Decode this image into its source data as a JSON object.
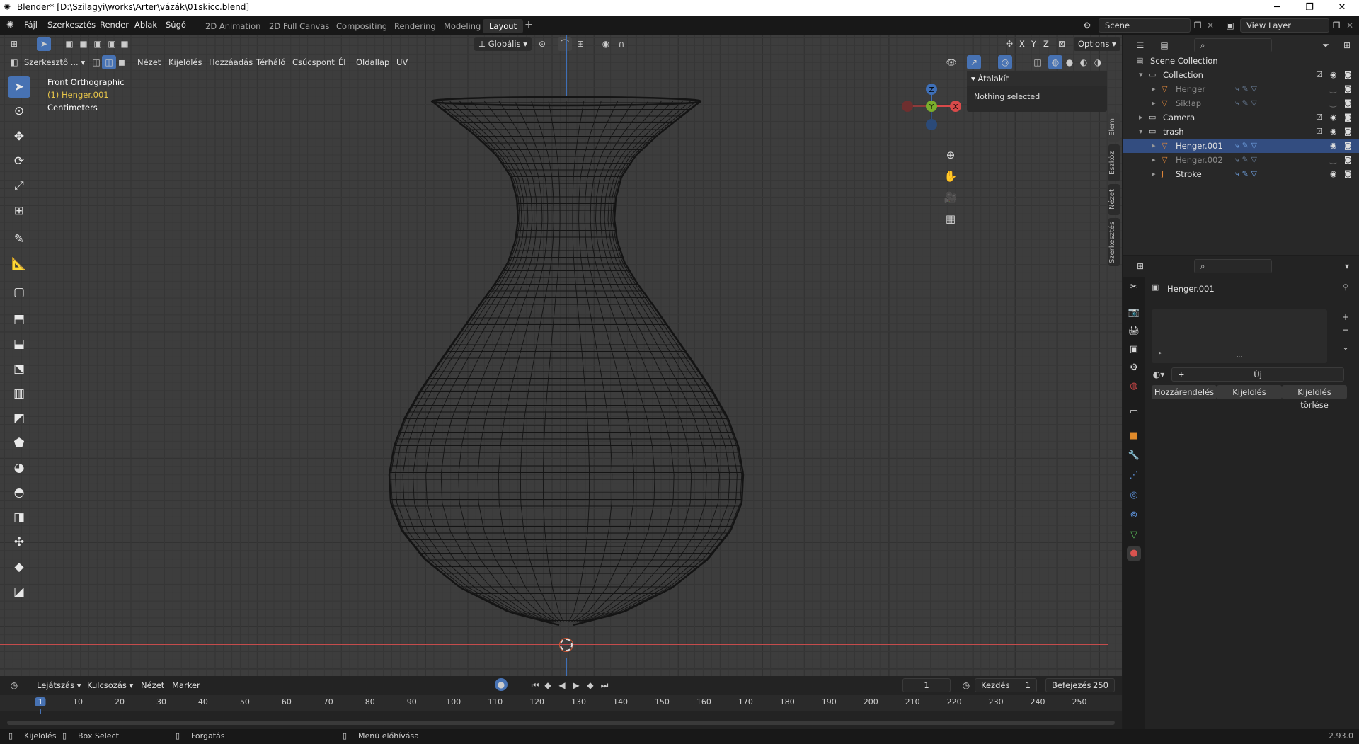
{
  "window": {
    "title": "Blender* [D:\\Szilagyi\\works\\Arter\\vázák\\01skicc.blend]"
  },
  "menu": {
    "items": [
      "Fájl",
      "Szerkesztés",
      "Render",
      "Ablak",
      "Súgó"
    ]
  },
  "workspaces": [
    "2D Animation",
    "2D Full Canvas",
    "Compositing",
    "Rendering",
    "Modeling",
    "Layout"
  ],
  "workspace_active": "Layout",
  "scene": {
    "label": "Scene",
    "view_layer": "View Layer"
  },
  "viewport": {
    "mode": "Szerkesztő ...",
    "menus": [
      "Nézet",
      "Kijelölés",
      "Hozzáadás",
      "Térháló",
      "Csúcspont",
      "Él",
      "Oldallap",
      "UV"
    ],
    "orientation": "Globális",
    "options": "Options",
    "axes": [
      "X",
      "Y",
      "Z"
    ],
    "overlay_view": "Front Orthographic",
    "overlay_object": "(1) Henger.001",
    "overlay_units": "Centimeters",
    "npanel_header": "Átalakít",
    "npanel_text": "Nothing selected",
    "side_tabs": [
      "Elem",
      "Eszköz",
      "Nézet",
      "Szerkesztés"
    ],
    "gizmo": {
      "x": "X",
      "y": "Y",
      "z": "Z"
    }
  },
  "timeline": {
    "menus": [
      "Lejátszás",
      "Kulcsozás",
      "Nézet",
      "Marker"
    ],
    "current_frame": "1",
    "start_label": "Kezdés",
    "start": "1",
    "end_label": "Befejezés",
    "end": "250",
    "ticks": [
      "1",
      "10",
      "20",
      "30",
      "40",
      "50",
      "60",
      "70",
      "80",
      "90",
      "100",
      "110",
      "120",
      "130",
      "140",
      "150",
      "160",
      "170",
      "180",
      "190",
      "200",
      "210",
      "220",
      "230",
      "240",
      "250"
    ]
  },
  "status": {
    "items": [
      "Kijelölés",
      "Box Select",
      "Forgatás",
      "Menü előhívása"
    ],
    "version": "2.93.0"
  },
  "outliner": {
    "rows": [
      {
        "name": "Scene Collection",
        "indent": 0,
        "kind": "scene"
      },
      {
        "name": "Collection",
        "indent": 1,
        "kind": "collection"
      },
      {
        "name": "Henger",
        "indent": 2,
        "kind": "mesh",
        "dim": true
      },
      {
        "name": "Sik!ap",
        "indent": 2,
        "kind": "mesh",
        "dim": true
      },
      {
        "name": "Camera",
        "indent": 1,
        "kind": "collection"
      },
      {
        "name": "trash",
        "indent": 1,
        "kind": "collection"
      },
      {
        "name": "Henger.001",
        "indent": 2,
        "kind": "mesh",
        "selected": true
      },
      {
        "name": "Henger.002",
        "indent": 2,
        "kind": "mesh",
        "dim": true
      },
      {
        "name": "Stroke",
        "indent": 2,
        "kind": "gpencil"
      }
    ]
  },
  "properties": {
    "object_name": "Henger.001",
    "new_button": "Új",
    "buttons": [
      "Hozzárendelés",
      "Kijelölés",
      "Kijelölés törlése"
    ]
  },
  "colors": {
    "accent": "#4772b3",
    "selected_row": "#334d80",
    "timeline_marker": "#4772b3",
    "axis_red": "#d94a4a"
  }
}
